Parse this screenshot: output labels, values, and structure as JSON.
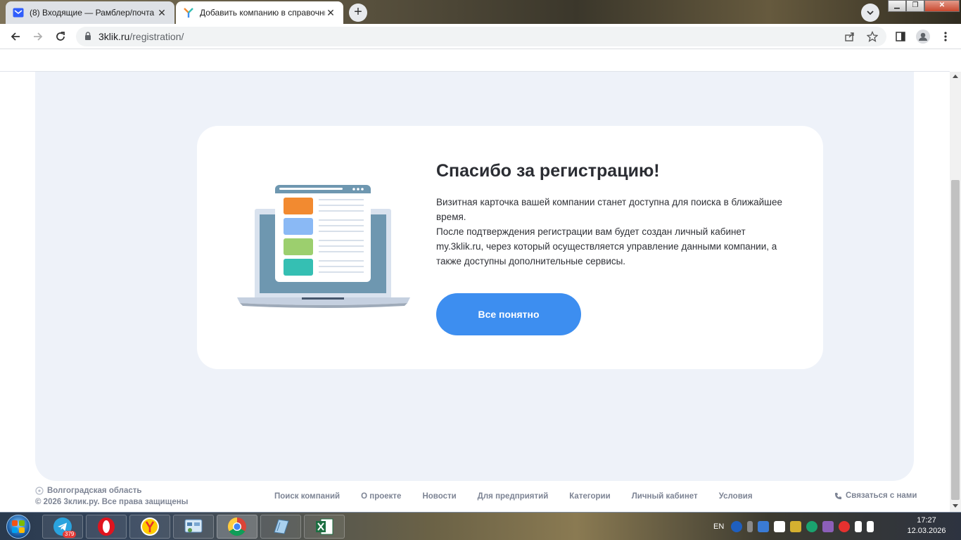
{
  "browser": {
    "tabs": [
      {
        "title": "(8) Входящие — Рамблер/почта",
        "active": false
      },
      {
        "title": "Добавить компанию в справочник",
        "active": true
      }
    ],
    "url_domain": "3klik.ru",
    "url_path": "/registration/"
  },
  "card": {
    "title": "Спасибо за регистрацию!",
    "paragraph1": "Визитная карточка вашей компании станет доступна для поиска в ближайшее время.",
    "paragraph2": "После подтверждения регистрации вам будет создан личный кабинет my.3klik.ru, через который осуществляется управление данными компании, а также доступны дополнительные сервисы.",
    "button_label": "Все понятно"
  },
  "footer": {
    "region": "Волгоградская область",
    "copyright": "© 2026 3клик.ру. Все права защищены",
    "links": [
      "Поиск компаний",
      "О проекте",
      "Новости",
      "Для предприятий",
      "Категории",
      "Личный кабинет",
      "Условия"
    ],
    "contact": "Связаться с нами"
  },
  "taskbar": {
    "telegram_badge": "379",
    "language": "EN",
    "time": "17:27",
    "date": "12.03.2026"
  },
  "colors": {
    "accent_button": "#3d8ef0",
    "panel_bg": "#eef2f9",
    "illus_orange": "#f28a30",
    "illus_blue": "#8ab9f5",
    "illus_green": "#9ccf6e",
    "illus_teal": "#35bfb3"
  }
}
